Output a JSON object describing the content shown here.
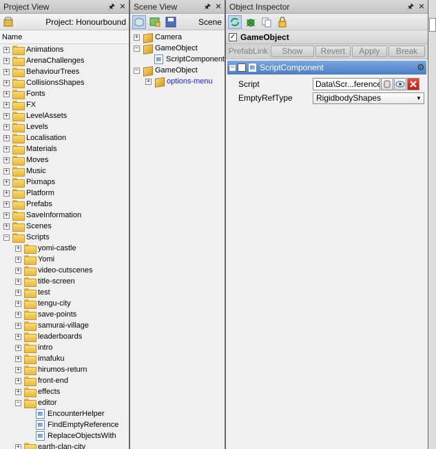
{
  "project_view": {
    "title": "Project View",
    "project_label": "Project: Honourbound",
    "column_name": "Name",
    "items": [
      {
        "label": "Animations",
        "depth": 0,
        "type": "folder",
        "expander": "+"
      },
      {
        "label": "ArenaChallenges",
        "depth": 0,
        "type": "folder",
        "expander": "+"
      },
      {
        "label": "BehaviourTrees",
        "depth": 0,
        "type": "folder",
        "expander": "+"
      },
      {
        "label": "CollisionsShapes",
        "depth": 0,
        "type": "folder",
        "expander": "+"
      },
      {
        "label": "Fonts",
        "depth": 0,
        "type": "folder",
        "expander": "+"
      },
      {
        "label": "FX",
        "depth": 0,
        "type": "folder",
        "expander": "+"
      },
      {
        "label": "LevelAssets",
        "depth": 0,
        "type": "folder",
        "expander": "+"
      },
      {
        "label": "Levels",
        "depth": 0,
        "type": "folder",
        "expander": "+"
      },
      {
        "label": "Localisation",
        "depth": 0,
        "type": "folder",
        "expander": "+"
      },
      {
        "label": "Materials",
        "depth": 0,
        "type": "folder",
        "expander": "+"
      },
      {
        "label": "Moves",
        "depth": 0,
        "type": "folder",
        "expander": "+"
      },
      {
        "label": "Music",
        "depth": 0,
        "type": "folder",
        "expander": "+"
      },
      {
        "label": "Pixmaps",
        "depth": 0,
        "type": "folder",
        "expander": "+"
      },
      {
        "label": "Platform",
        "depth": 0,
        "type": "folder",
        "expander": "+"
      },
      {
        "label": "Prefabs",
        "depth": 0,
        "type": "folder",
        "expander": "+"
      },
      {
        "label": "SaveInformation",
        "depth": 0,
        "type": "folder",
        "expander": "+"
      },
      {
        "label": "Scenes",
        "depth": 0,
        "type": "folder",
        "expander": "+"
      },
      {
        "label": "Scripts",
        "depth": 0,
        "type": "folder",
        "expander": "-"
      },
      {
        "label": "yomi-castle",
        "depth": 1,
        "type": "folder",
        "expander": "+"
      },
      {
        "label": "Yomi",
        "depth": 1,
        "type": "folder",
        "expander": "+"
      },
      {
        "label": "video-cutscenes",
        "depth": 1,
        "type": "folder",
        "expander": "+"
      },
      {
        "label": "title-screen",
        "depth": 1,
        "type": "folder",
        "expander": "+"
      },
      {
        "label": "test",
        "depth": 1,
        "type": "folder",
        "expander": "+"
      },
      {
        "label": "tengu-city",
        "depth": 1,
        "type": "folder",
        "expander": "+"
      },
      {
        "label": "save-points",
        "depth": 1,
        "type": "folder",
        "expander": "+"
      },
      {
        "label": "samurai-village",
        "depth": 1,
        "type": "folder",
        "expander": "+"
      },
      {
        "label": "leaderboards",
        "depth": 1,
        "type": "folder",
        "expander": "+"
      },
      {
        "label": "intro",
        "depth": 1,
        "type": "folder",
        "expander": "+"
      },
      {
        "label": "imafuku",
        "depth": 1,
        "type": "folder",
        "expander": "+"
      },
      {
        "label": "hirumos-return",
        "depth": 1,
        "type": "folder",
        "expander": "+"
      },
      {
        "label": "front-end",
        "depth": 1,
        "type": "folder",
        "expander": "+"
      },
      {
        "label": "effects",
        "depth": 1,
        "type": "folder",
        "expander": "+"
      },
      {
        "label": "editor",
        "depth": 1,
        "type": "folder",
        "expander": "-"
      },
      {
        "label": "EncounterHelper",
        "depth": 2,
        "type": "file",
        "expander": ""
      },
      {
        "label": "FindEmptyReference",
        "depth": 2,
        "type": "file",
        "expander": ""
      },
      {
        "label": "ReplaceObjectsWith",
        "depth": 2,
        "type": "file",
        "expander": ""
      },
      {
        "label": "earth-clan-city",
        "depth": 1,
        "type": "folder",
        "expander": "+"
      }
    ]
  },
  "scene_view": {
    "title": "Scene View",
    "scene_label": "Scene",
    "items": [
      {
        "label": "Camera",
        "depth": 0,
        "type": "cube",
        "expander": "+",
        "link": false
      },
      {
        "label": "GameObject",
        "depth": 0,
        "type": "cube",
        "expander": "-",
        "link": false
      },
      {
        "label": "ScriptComponent",
        "depth": 1,
        "type": "file",
        "expander": "",
        "link": false
      },
      {
        "label": "GameObject",
        "depth": 0,
        "type": "cube",
        "expander": "-",
        "link": false
      },
      {
        "label": "options-menu",
        "depth": 1,
        "type": "prefab",
        "expander": "+",
        "link": true
      }
    ]
  },
  "inspector": {
    "title": "Object Inspector",
    "gameobject_label": "GameObject",
    "buttons": {
      "prefablink": "PrefabLink",
      "show": "Show",
      "revert": "Revert",
      "apply": "Apply",
      "break": "Break"
    },
    "component": {
      "name": "ScriptComponent",
      "script_label": "Script",
      "script_value": "Data\\Scr...ferences",
      "emptyref_label": "EmptyRefType",
      "emptyref_value": "RigidbodyShapes"
    }
  },
  "colors": {
    "accent_blue": "#4d7cc4",
    "link_blue": "#1a1aff",
    "folder_yellow": "#e6b941"
  }
}
